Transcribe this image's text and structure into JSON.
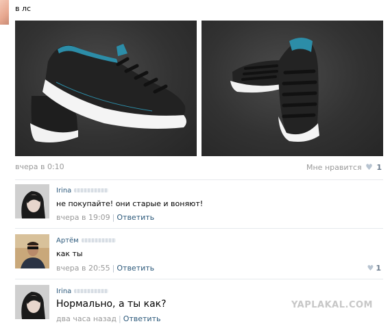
{
  "post": {
    "text": "в лс",
    "date": "вчера в 0:10",
    "like_label": "Мне нравится",
    "like_count": "1"
  },
  "comments": [
    {
      "author": "Irina",
      "text": "не покупайте! они старые и воняют!",
      "time": "вчера в 19:09",
      "reply_label": "Ответить",
      "likes": ""
    },
    {
      "author": "Артём",
      "text": "как ты",
      "time": "вчера в 20:55",
      "reply_label": "Ответить",
      "likes": "1"
    },
    {
      "author": "Irina",
      "text": "Нормально, а ты как?",
      "time": "два часа назад",
      "reply_label": "Ответить",
      "likes": ""
    }
  ],
  "watermark": "YAPLAKAL.COM",
  "icons": {
    "like": "heart-icon"
  }
}
